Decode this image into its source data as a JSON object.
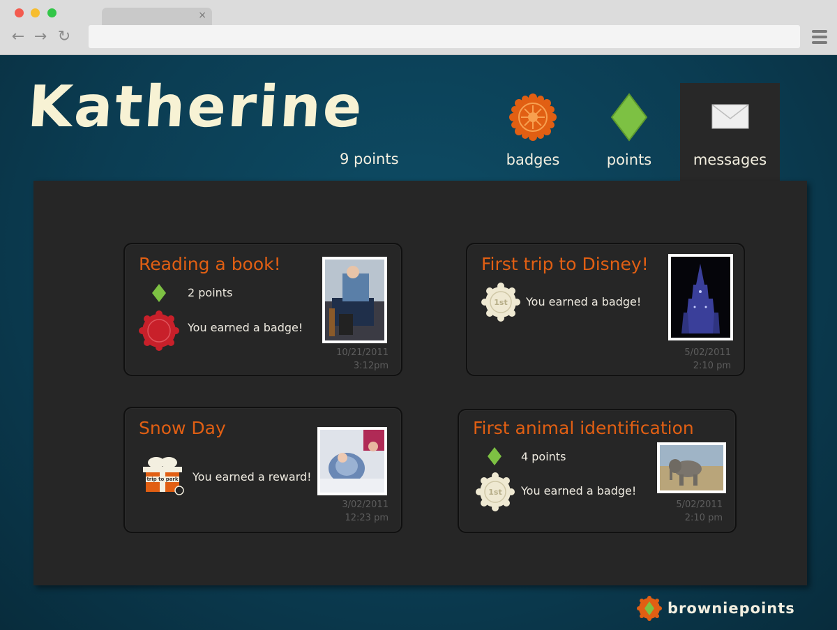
{
  "page": {
    "user_name": "Katherine",
    "points_total": "9 points"
  },
  "nav": {
    "badges_label": "badges",
    "points_label": "points",
    "messages_label": "messages"
  },
  "messages": [
    {
      "title": "Reading a book!",
      "points_text": "2  points",
      "badge_text": "You earned a badge!",
      "date": "10/21/2011",
      "time": "3:12pm"
    },
    {
      "title": "First trip to Disney!",
      "badge_text": "You earned a badge!",
      "date": "5/02/2011",
      "time": "2:10 pm"
    },
    {
      "title": "Snow Day",
      "reward_text": "You earned a reward!",
      "reward_tag": "trip to park",
      "date": "3/02/2011",
      "time": "12:23 pm"
    },
    {
      "title": "First animal identification",
      "points_text": "4  points",
      "badge_text": "You earned a badge!",
      "date": "5/02/2011",
      "time": "2:10 pm"
    }
  ],
  "footer": {
    "brand": "browniepoints"
  },
  "colors": {
    "accent": "#e15f13",
    "points_green": "#7dc143",
    "badge_red": "#c8202a",
    "panel": "#262626",
    "background": "#0b3d53"
  },
  "icons": [
    "close-icon",
    "back-icon",
    "forward-icon",
    "reload-icon",
    "menu-icon",
    "badge-sunburst-icon",
    "points-diamond-icon",
    "envelope-icon",
    "first-badge-icon",
    "gift-icon"
  ]
}
